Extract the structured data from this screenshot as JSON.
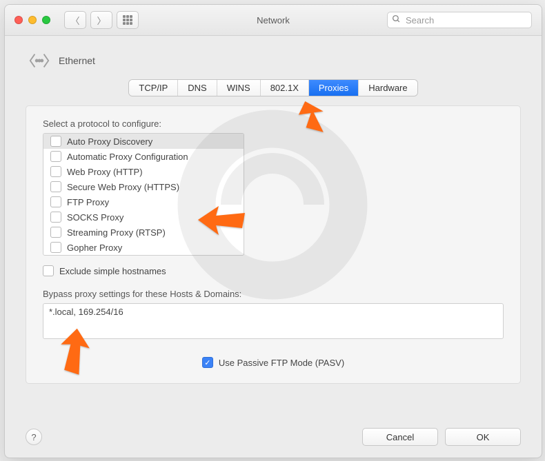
{
  "window": {
    "title": "Network"
  },
  "search": {
    "placeholder": "Search"
  },
  "header": {
    "label": "Ethernet"
  },
  "tabs": [
    {
      "label": "TCP/IP",
      "selected": false
    },
    {
      "label": "DNS",
      "selected": false
    },
    {
      "label": "WINS",
      "selected": false
    },
    {
      "label": "802.1X",
      "selected": false
    },
    {
      "label": "Proxies",
      "selected": true
    },
    {
      "label": "Hardware",
      "selected": false
    }
  ],
  "section_label": "Select a protocol to configure:",
  "protocols": [
    {
      "label": "Auto Proxy Discovery",
      "checked": false
    },
    {
      "label": "Automatic Proxy Configuration",
      "checked": false
    },
    {
      "label": "Web Proxy (HTTP)",
      "checked": false
    },
    {
      "label": "Secure Web Proxy (HTTPS)",
      "checked": false
    },
    {
      "label": "FTP Proxy",
      "checked": false
    },
    {
      "label": "SOCKS Proxy",
      "checked": false
    },
    {
      "label": "Streaming Proxy (RTSP)",
      "checked": false
    },
    {
      "label": "Gopher Proxy",
      "checked": false
    }
  ],
  "exclude": {
    "label": "Exclude simple hostnames",
    "checked": false
  },
  "bypass": {
    "label": "Bypass proxy settings for these Hosts & Domains:",
    "value": "*.local, 169.254/16"
  },
  "pasv": {
    "label": "Use Passive FTP Mode (PASV)",
    "checked": true
  },
  "buttons": {
    "help": "?",
    "cancel": "Cancel",
    "ok": "OK"
  }
}
